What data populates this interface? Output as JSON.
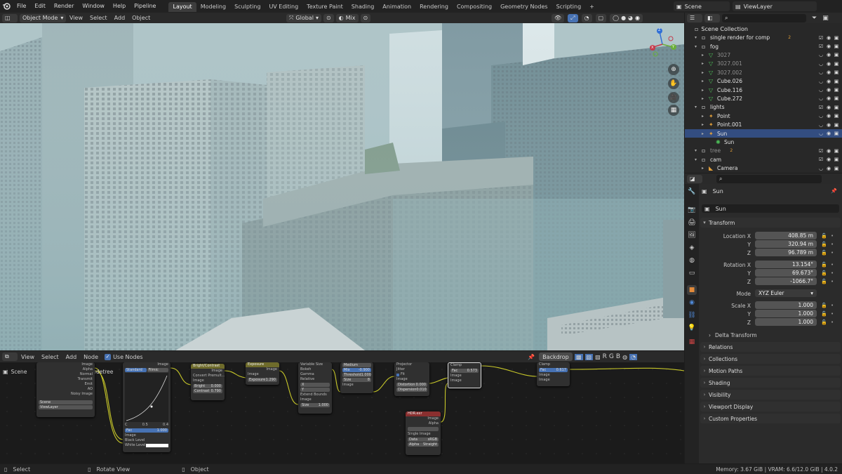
{
  "menu": {
    "items": [
      "File",
      "Edit",
      "Render",
      "Window",
      "Help",
      "Pipeline"
    ]
  },
  "workspaces": {
    "tabs": [
      "Layout",
      "Modeling",
      "Sculpting",
      "UV Editing",
      "Texture Paint",
      "Shading",
      "Animation",
      "Rendering",
      "Compositing",
      "Geometry Nodes",
      "Scripting"
    ],
    "active": "Layout",
    "add": "+"
  },
  "topright": {
    "scene": "Scene",
    "view_layer": "ViewLayer"
  },
  "viewport": {
    "mode": "Object Mode",
    "view": "View",
    "select": "Select",
    "add": "Add",
    "object": "Object",
    "orientation": "Global",
    "shading": "Mix",
    "gizmo": {
      "x": "X",
      "y": "Y",
      "z": "Z"
    }
  },
  "node_editor": {
    "view": "View",
    "select": "Select",
    "add": "Add",
    "node": "Node",
    "use_nodes": "Use Nodes",
    "backdrop": "Backdrop",
    "channels": [
      "R",
      "G",
      "B"
    ],
    "breadcrumb_scene": "Scene",
    "breadcrumb_tree": "Compositing Nodetree",
    "render_layers": {
      "outputs": [
        "Image",
        "Alpha",
        "Normal",
        "Transmit",
        "Emit",
        "AO",
        "Noisy Image"
      ],
      "scene": "Scene",
      "layer": "ViewLayer"
    },
    "curves": {
      "title": "RGB Curves",
      "mode_a": "Standard",
      "mode_b": "Filmic",
      "fac": "Fac",
      "fac_val": "1.000",
      "image": "Image",
      "black": "Black Level",
      "white": "White Level",
      "out": "Image",
      "c_label": "C",
      "c_val": "0.5",
      "c2_val": "0.4"
    },
    "bc": {
      "title": "Bright/Contrast",
      "out": "Image",
      "convert": "Convert Premult...",
      "image": "Image",
      "bright": "Bright",
      "bright_val": "0.000",
      "contrast": "Contrast",
      "contrast_val": "0.790"
    },
    "exposure": {
      "title": "Exposure",
      "out": "Image",
      "image": "Image",
      "exp": "Exposure",
      "exp_val": "1.290"
    },
    "glare": {
      "rows": [
        "Variable Size",
        "Bokeh",
        "Gamma",
        "Relative",
        "X",
        "Y",
        "Extend Bounds",
        "Image",
        "Size"
      ],
      "size_val": "1.000"
    },
    "denoise": {
      "mode": "Medium",
      "mix": "Mix",
      "mix_val": "-0.900",
      "thresh": "Threshold",
      "thresh_val": "1.000",
      "size": "Size",
      "size_val": "8",
      "image": "Image"
    },
    "lens": {
      "rows": [
        "Projector",
        "Jitter",
        "Fit",
        "Image",
        "Distortion",
        "Dispersion"
      ],
      "dist_val": "0.000",
      "disp_val": "0.010"
    },
    "comp": {
      "rows": [
        "Clamp",
        "Fac",
        "Image",
        "Image"
      ],
      "fac_val": "0.573"
    },
    "viewer": {
      "clamp": "Clamp",
      "fac": "Fac",
      "fac_val": "0.617",
      "image": "Image",
      "image2": "Image"
    },
    "image_node": {
      "title": "HDR.exr",
      "image": "Image",
      "alpha": "Alpha",
      "single": "Single Image",
      "data": "Data",
      "srgb": "sRGB",
      "alpha2": "Alpha",
      "straight": "Straight"
    }
  },
  "status": {
    "select": "Select",
    "rotate": "Rotate View",
    "object": "Object",
    "memory": "Memory: 3.67 GiB | VRAM: 6.6/12.0 GiB | 4.0.2"
  },
  "outliner": {
    "root": "Scene Collection",
    "rows": [
      {
        "name": "single render for comp",
        "depth": 1,
        "kind": "collection",
        "badge": "2"
      },
      {
        "name": "fog",
        "depth": 1,
        "kind": "collection"
      },
      {
        "name": "3027",
        "depth": 2,
        "kind": "mesh",
        "dim": true
      },
      {
        "name": "3027.001",
        "depth": 2,
        "kind": "mesh",
        "dim": true
      },
      {
        "name": "3027.002",
        "depth": 2,
        "kind": "mesh",
        "dim": true
      },
      {
        "name": "Cube.026",
        "depth": 2,
        "kind": "mesh"
      },
      {
        "name": "Cube.116",
        "depth": 2,
        "kind": "mesh"
      },
      {
        "name": "Cube.272",
        "depth": 2,
        "kind": "mesh"
      },
      {
        "name": "lights",
        "depth": 1,
        "kind": "collection"
      },
      {
        "name": "Point",
        "depth": 2,
        "kind": "light"
      },
      {
        "name": "Point.001",
        "depth": 2,
        "kind": "light"
      },
      {
        "name": "Sun",
        "depth": 2,
        "kind": "light",
        "selected": true
      },
      {
        "name": "Sun",
        "depth": 3,
        "kind": "lightdata"
      },
      {
        "name": "tree",
        "depth": 1,
        "kind": "collection",
        "dim": true,
        "badge": "2"
      },
      {
        "name": "cam",
        "depth": 1,
        "kind": "collection"
      },
      {
        "name": "Camera",
        "depth": 2,
        "kind": "camera"
      }
    ]
  },
  "properties": {
    "object_name": "Sun",
    "data_name": "Sun",
    "transform": "Transform",
    "location_x_label": "Location X",
    "location_x": "408.85 m",
    "y_label": "Y",
    "location_y": "320.94 m",
    "z_label": "Z",
    "location_z": "96.789 m",
    "rotation_x_label": "Rotation X",
    "rotation_x": "13.154°",
    "rotation_y": "69.673°",
    "rotation_z": "-1066.7°",
    "mode_label": "Mode",
    "mode": "XYZ Euler",
    "scale_x_label": "Scale X",
    "scale_x": "1.000",
    "scale_y": "1.000",
    "scale_z": "1.000",
    "delta": "Delta Transform",
    "panels": [
      "Relations",
      "Collections",
      "Motion Paths",
      "Shading",
      "Visibility",
      "Viewport Display",
      "Custom Properties"
    ]
  },
  "colors": {
    "accent": "#4772b3",
    "selected_row": "#334d80",
    "node_yellow": "#c7c729",
    "light_icon": "#e09e3a",
    "collection_icon": "#e0e0e0",
    "mesh_green": "#4ec35a"
  }
}
